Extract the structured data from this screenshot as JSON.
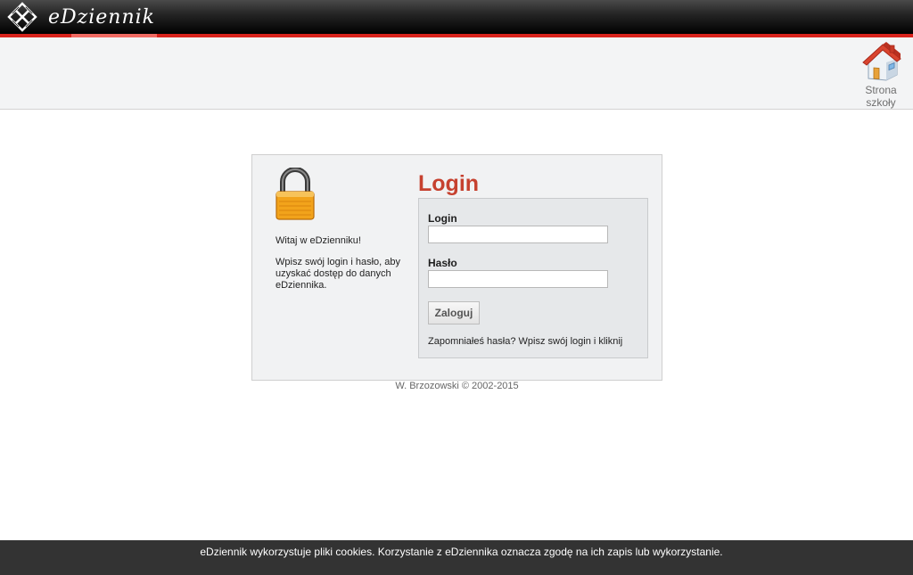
{
  "app": {
    "logo_text": "eDziennik",
    "logo_icon": "knot-logo-icon"
  },
  "header": {
    "school_link": {
      "icon": "house-icon",
      "line1": "Strona",
      "line2": "szkoły"
    }
  },
  "login": {
    "lock_icon": "padlock-icon",
    "welcome": "Witaj w eDzienniku!",
    "instruction": "Wpisz swój login i hasło, aby uzyskać dostęp do danych eDziennika.",
    "title": "Login",
    "login_label": "Login",
    "login_value": "",
    "password_label": "Hasło",
    "password_value": "",
    "submit_label": "Zaloguj",
    "forgot_text": "Zapomniałeś hasła? Wpisz swój login i kliknij"
  },
  "footer": {
    "copyright": "W. Brzozowski © 2002-2015"
  },
  "cookie_bar": {
    "text": "eDziennik wykorzystuje pliki cookies. Korzystanie z eDziennika oznacza zgodę na ich zapis lub wykorzystanie."
  },
  "colors": {
    "accent_red": "#d8231c",
    "title_red": "#c6412f",
    "cookie_bar_bg": "#333333"
  }
}
